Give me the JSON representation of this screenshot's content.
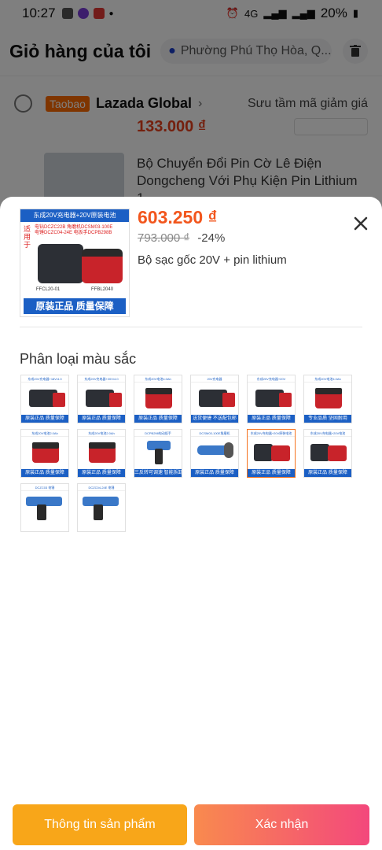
{
  "status_bar": {
    "time": "10:27",
    "net_4g": "4G",
    "battery": "20%"
  },
  "cart": {
    "title": "Giỏ hàng của tôi",
    "address": "Phường Phú Thọ Hòa, Q...",
    "store_tag": "Taobao",
    "seller": "Lazada Global",
    "voucher": "Sưu tầm mã giảm giá",
    "item_price": "133.000 ₫",
    "item_title": "Bộ Chuyển Đổi Pin Cờ Lê Điện\nDongcheng Với Phụ Kiện Pin Lithium 1..."
  },
  "sheet": {
    "price": "603.250 ₫",
    "original_price": "793.000 ₫",
    "discount": "-24%",
    "variant_name": "Bộ sạc gốc 20V + pin lithium",
    "section_title": "Phân loại màu sắc",
    "thumb": {
      "banner": "东成20V充电器+20V原装电池",
      "side": "适用于",
      "codes": "电钻DCZC22B  角磨机DCSM03-100E\n电锤DCZC04-24E  电扳手DCPB298B",
      "label_left": "FFCL20-01",
      "label_right": "FFBL2040",
      "bottom": "原装正品 质量保障"
    },
    "options": [
      {
        "top": "东成20V充电器+18V/4.0",
        "bottom": "原装正品 质量保障",
        "kind": "charger"
      },
      {
        "top": "东成20V充电器+20V/4.0",
        "bottom": "原装正品 质量保障",
        "kind": "charger"
      },
      {
        "top": "东成20V电池4.0Ah",
        "bottom": "原装正品 质量保障",
        "kind": "battery"
      },
      {
        "top": "20V充电器",
        "bottom": "送货便捷 不送配包邮",
        "kind": "charger"
      },
      {
        "top": "东成20V充电器+20V",
        "bottom": "原装正品 质量保障",
        "kind": "charger"
      },
      {
        "top": "东成20V电池4.0Ah",
        "bottom": "专业品质 坚固耐用",
        "kind": "battery"
      },
      {
        "top": "东成20V电池2.0Ah",
        "bottom": "原装正品 质量保障",
        "kind": "battery"
      },
      {
        "top": "东成20V电池2.0Ah",
        "bottom": "原装正品 质量保障",
        "kind": "battery"
      },
      {
        "top": "DCPB298电动扳手",
        "bottom": "三反转可调速 智能拆卸",
        "kind": "drill"
      },
      {
        "top": "DCSM03-100E角磨机",
        "bottom": "原装正品 质量保障",
        "kind": "grinder"
      },
      {
        "top": "东成20V充电器+20V原装电池",
        "bottom": "原装正品 质量保障",
        "kind": "combo"
      },
      {
        "top": "东成20V充电器+20V电池",
        "bottom": "原装正品 质量保障",
        "kind": "combo"
      },
      {
        "top": "DCZC03 电锤",
        "bottom": "",
        "kind": "hammer"
      },
      {
        "top": "DCZC04-24E 电锤",
        "bottom": "",
        "kind": "hammer"
      }
    ],
    "selected_index": 10,
    "btn_info": "Thông tin sản phẩm",
    "btn_confirm": "Xác nhận"
  },
  "colors": {
    "accent": "#f2561d",
    "info_button": "#f8a619",
    "confirm_start": "#f98a4e",
    "confirm_end": "#f3487c",
    "brand_blue": "#1b5fc4"
  }
}
